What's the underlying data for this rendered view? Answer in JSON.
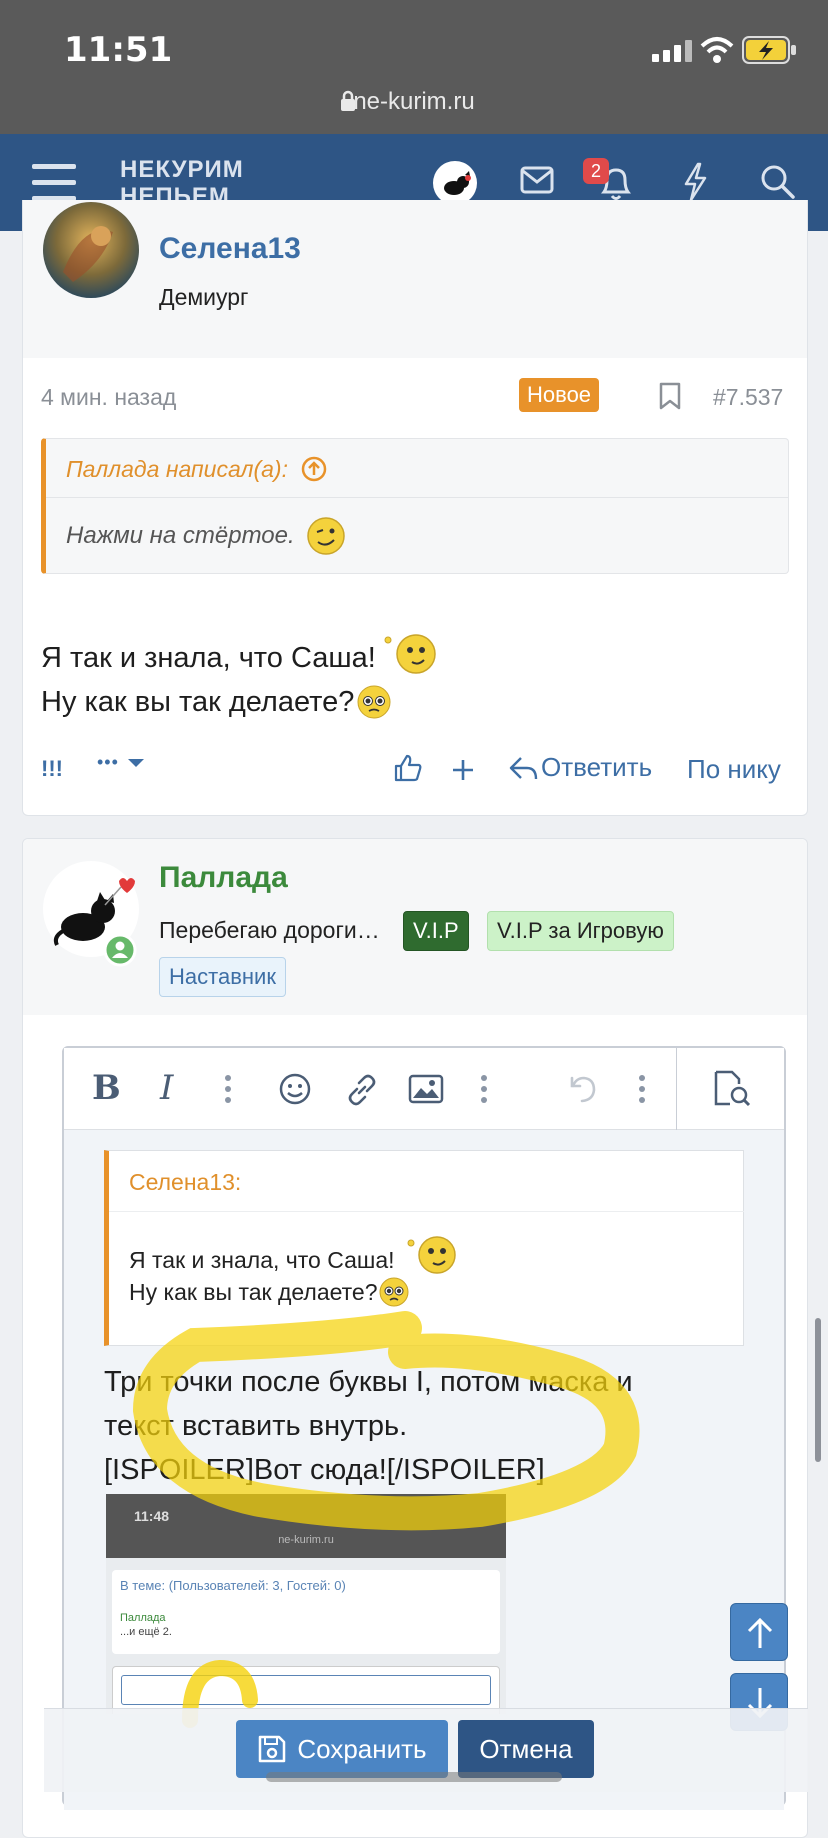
{
  "status": {
    "time": "11:51",
    "url": "ne-kurim.ru"
  },
  "nav": {
    "logo_line1": "НЕКУРИМ",
    "logo_line2": "НЕПЬЕМ…",
    "notifications_count": "2"
  },
  "post1": {
    "username": "Селена13",
    "user_title": "Демиург",
    "time_ago": "4 мин. назад",
    "new_badge": "Новое",
    "post_number": "#7.537",
    "quote_author": "Паллада написал(а):",
    "quote_text": "Нажми на стёртое.",
    "message_line1": "Я так и знала, что Саша!",
    "message_line2": "Ну как вы так делаете?",
    "action_exclaim": "!!!",
    "action_more": "•••",
    "action_reply": "Ответить",
    "action_by_nick": "По нику"
  },
  "post2": {
    "username": "Паллада",
    "user_status": "Перебегаю дороги…",
    "tags": [
      "V.I.P",
      "V.I.P за Игровую",
      "Наставник"
    ]
  },
  "editor": {
    "quote_author": "Селена13:",
    "quote_line1": "Я так и знала, что Саша!",
    "quote_line2": "Ну как вы так делаете?",
    "text_line1": "Три точки после буквы I, потом маска и",
    "text_line2": "текст вставить внутрь.",
    "text_line3": "[ISPOILER]Вот сюда![/ISPOILER]",
    "thumb": {
      "time": "11:48",
      "url": "ne-kurim.ru",
      "heading": "В теме: (Пользователей: 3, Гостей: 0)",
      "name": "Паллада",
      "sub": "...и ещё 2."
    }
  },
  "buttons": {
    "save": "Сохранить",
    "cancel": "Отмена"
  },
  "colors": {
    "nav": "#2e5585",
    "accent_orange": "#e8922a",
    "link_blue": "#3d6ea5",
    "highlight": "#f5d20a"
  }
}
